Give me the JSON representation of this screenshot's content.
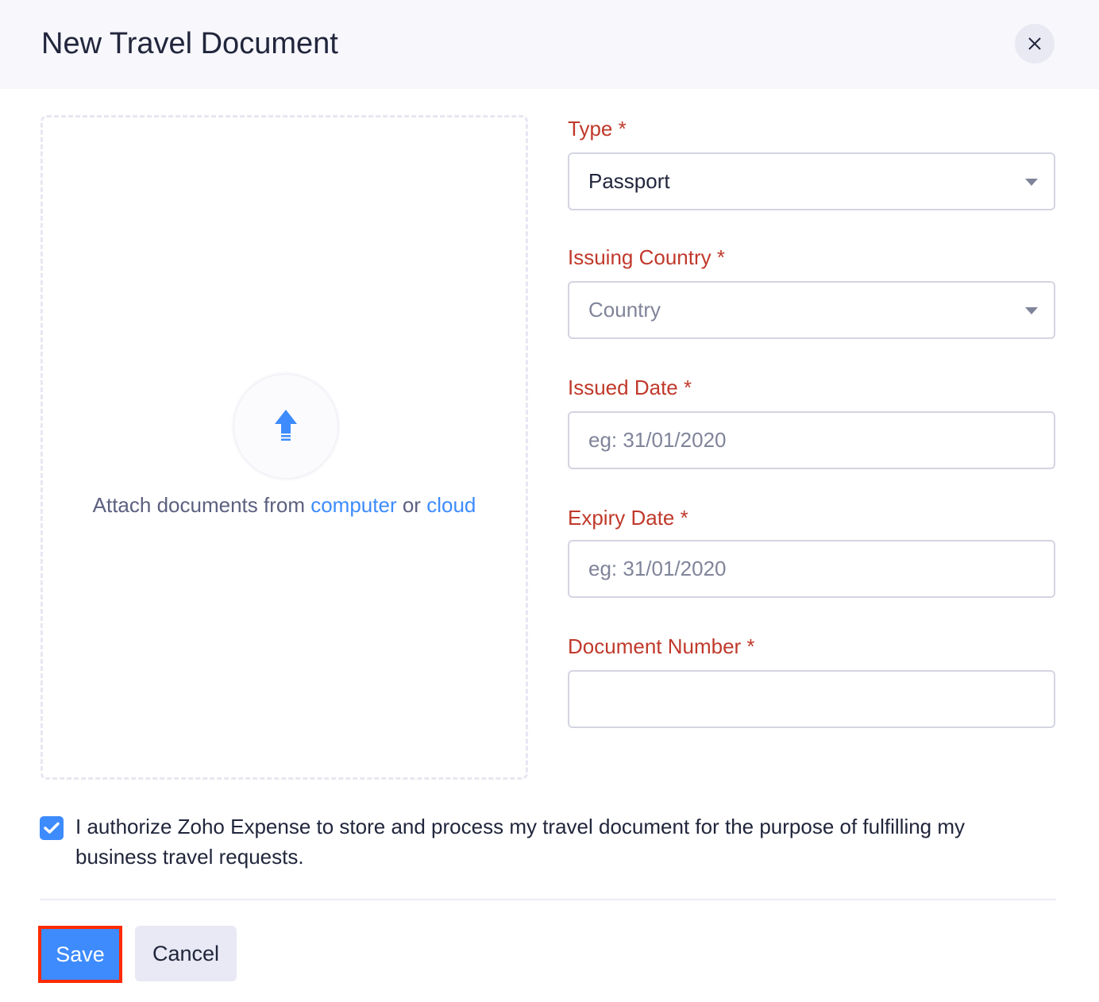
{
  "header": {
    "title": "New Travel Document"
  },
  "upload": {
    "prefix": "Attach documents from",
    "computer": "computer",
    "or": "or",
    "cloud": "cloud"
  },
  "form": {
    "type": {
      "label": "Type *",
      "value": "Passport"
    },
    "country": {
      "label": "Issuing Country *",
      "placeholder": "Country"
    },
    "issued": {
      "label": "Issued Date *",
      "placeholder": "eg: 31/01/2020"
    },
    "expiry": {
      "label": "Expiry Date *",
      "placeholder": "eg: 31/01/2020"
    },
    "docnum": {
      "label": "Document Number *",
      "value": ""
    }
  },
  "consent": {
    "checked": true,
    "text": "I authorize Zoho Expense to store and process my travel document for the purpose of fulfilling my business travel requests."
  },
  "footer": {
    "save": "Save",
    "cancel": "Cancel"
  },
  "colors": {
    "accent": "#3d8bfd",
    "required_label": "#c0392b",
    "highlight": "#ff2a00"
  }
}
